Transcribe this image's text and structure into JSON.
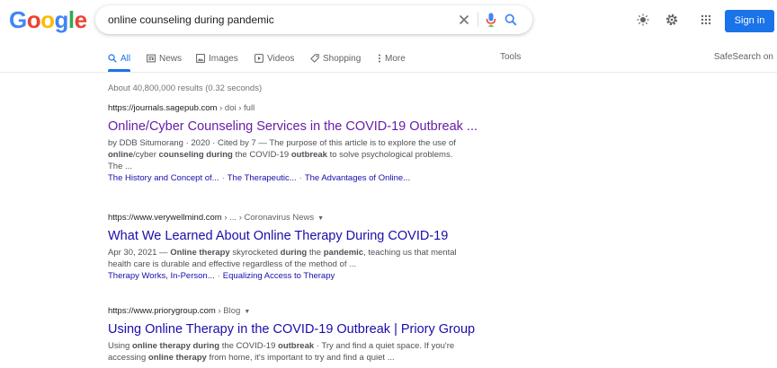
{
  "header": {
    "logo_letters": [
      "G",
      "o",
      "o",
      "g",
      "l",
      "e"
    ],
    "search_query": "online counseling during pandemic",
    "signin_label": "Sign in"
  },
  "tabs": {
    "all": "All",
    "news": "News",
    "images": "Images",
    "videos": "Videos",
    "shopping": "Shopping",
    "more": "More",
    "tools": "Tools",
    "safesearch": "SafeSearch on"
  },
  "stats": "About 40,800,000 results (0.32 seconds)",
  "results": [
    {
      "cite_domain": "https://journals.sagepub.com",
      "cite_path": " › doi › full",
      "title": "Online/Cyber Counseling Services in the COVID-19 Outbreak ...",
      "snippet_parts": [
        {
          "t": "by DDB Situmorang · 2020 · Cited by 7 — The purpose of this article is to explore the use of "
        },
        {
          "t": "online",
          "b": true
        },
        {
          "t": "/cyber "
        },
        {
          "t": "counseling",
          "b": true
        },
        {
          "t": " "
        },
        {
          "t": "during",
          "b": true
        },
        {
          "t": " the COVID-19 "
        },
        {
          "t": "outbreak",
          "b": true
        },
        {
          "t": " to solve psychological problems. The ..."
        }
      ],
      "sitelinks": [
        "The History and Concept of...",
        "The Therapeutic...",
        "The Advantages of Online..."
      ]
    },
    {
      "cite_domain": "https://www.verywellmind.com",
      "cite_path": " › ... › Coronavirus News",
      "title": "What We Learned About Online Therapy During COVID-19",
      "snippet_parts": [
        {
          "t": "Apr 30, 2021 — "
        },
        {
          "t": "Online therapy",
          "b": true
        },
        {
          "t": " skyrocketed "
        },
        {
          "t": "during",
          "b": true
        },
        {
          "t": " the "
        },
        {
          "t": "pandemic",
          "b": true
        },
        {
          "t": ", teaching us that mental health care is durable and effective regardless of the method of ..."
        }
      ],
      "sitelinks": [
        "Therapy Works, In-Person...",
        "Equalizing Access to Therapy"
      ]
    },
    {
      "cite_domain": "https://www.priorygroup.com",
      "cite_path": " › Blog",
      "title": "Using Online Therapy in the COVID-19 Outbreak | Priory Group",
      "snippet_parts": [
        {
          "t": "Using "
        },
        {
          "t": "online therapy during",
          "b": true
        },
        {
          "t": " the COVID-19 "
        },
        {
          "t": "outbreak",
          "b": true
        },
        {
          "t": " · Try and find a quiet space. If you're accessing "
        },
        {
          "t": "online therapy",
          "b": true
        },
        {
          "t": " from home, it's important to try and find a quiet ..."
        }
      ],
      "sitelinks": []
    }
  ],
  "icons": {
    "clear": "close-icon",
    "mic": "mic-icon",
    "search": "search-icon",
    "theme": "sun-icon",
    "settings": "gear-icon",
    "apps": "apps-grid-icon"
  },
  "colors": {
    "accent": "#1a73e8",
    "link": "#1a0dab",
    "visited": "#681da8"
  }
}
